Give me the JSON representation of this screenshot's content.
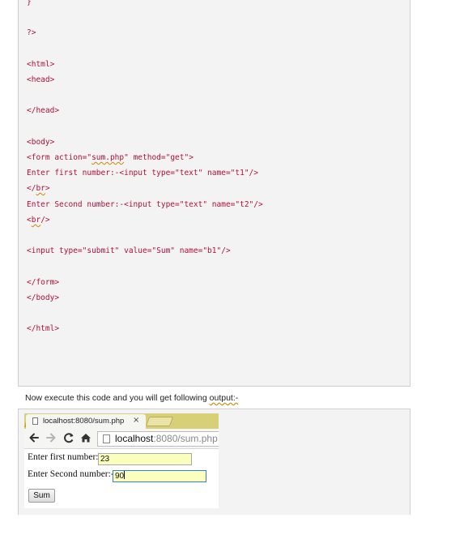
{
  "code": {
    "lines": [
      "}",
      "?>",
      "<html>",
      "<head>",
      "</head>",
      "<body>",
      "<form action=\"",
      "sum.php",
      "\" method=\"get\">",
      "Enter first number:-<input type=\"text\" name=\"t1\"/>",
      "</",
      "br",
      ">",
      "Enter Second number:-<input type=\"text\" name=\"t2\"/>",
      "<",
      "br",
      "/>",
      "<input type=\"submit\" value=\"Sum\" name=\"b1\"/>",
      "</form>",
      "</body>",
      "</html>"
    ]
  },
  "caption": {
    "prefix": "Now execute this code and you will get following ",
    "underlined": "output:-"
  },
  "browser": {
    "tab_title": "localhost:8080/sum.php",
    "tab_close": "×",
    "url_host": "localhost",
    "url_rest": ":8080/sum.php",
    "icons": [
      "back-arrow-icon",
      "forward-arrow-icon",
      "reload-icon",
      "home-icon",
      "page-icon"
    ]
  },
  "form": {
    "first_label": "Enter first number:-",
    "first_value": "23",
    "second_label": "Enter Second number:-",
    "second_value": "90",
    "submit_label": "Sum"
  }
}
